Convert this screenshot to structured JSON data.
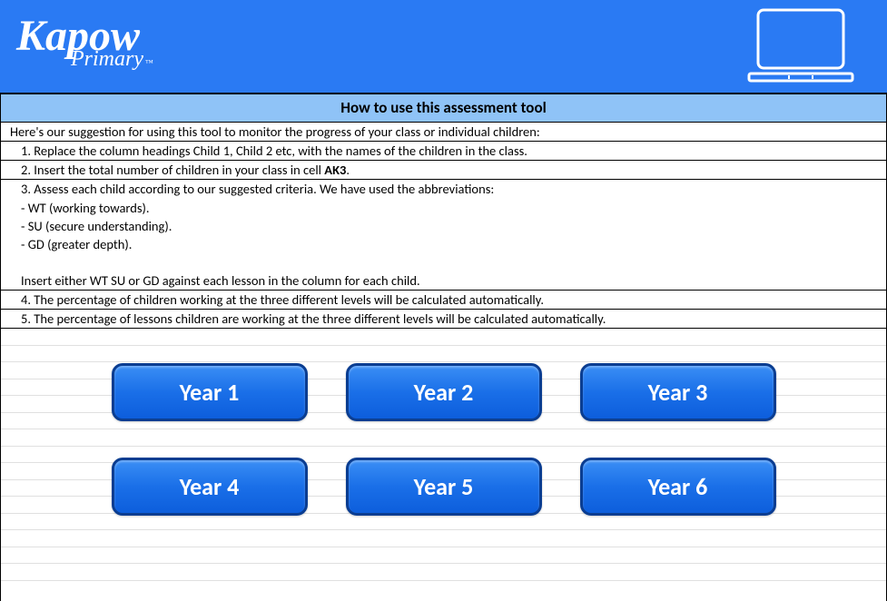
{
  "header": {
    "logo_main": "Kapow",
    "logo_sub": "Primary",
    "logo_tm": "™"
  },
  "title": "How to use this assessment tool",
  "instructions": {
    "intro": "Here's our suggestion for using this tool to monitor the progress of your class or individual children:",
    "step1": "1. Replace the column headings Child 1, Child 2 etc, with the names of the children in the class.",
    "step2_a": "2.  Insert the total number of children in your class in cell ",
    "step2_b": "AK3",
    "step2_c": ".",
    "step3": "3.  Assess each child according to our suggested criteria.  We have used the abbreviations:",
    "abbr_wt": "- WT (working towards).",
    "abbr_su": "- SU (secure understanding).",
    "abbr_gd": "- GD (greater depth).",
    "insert_note": "Insert either WT SU or GD against each lesson in the column for each child.",
    "step4": "4.  The percentage of children working at the three different levels will be calculated automatically.",
    "step5": "5. The percentage of lessons children are working at the three different levels will  be calculated automatically."
  },
  "buttons": {
    "year1": "Year 1",
    "year2": "Year 2",
    "year3": "Year 3",
    "year4": "Year 4",
    "year5": "Year 5",
    "year6": "Year 6"
  }
}
